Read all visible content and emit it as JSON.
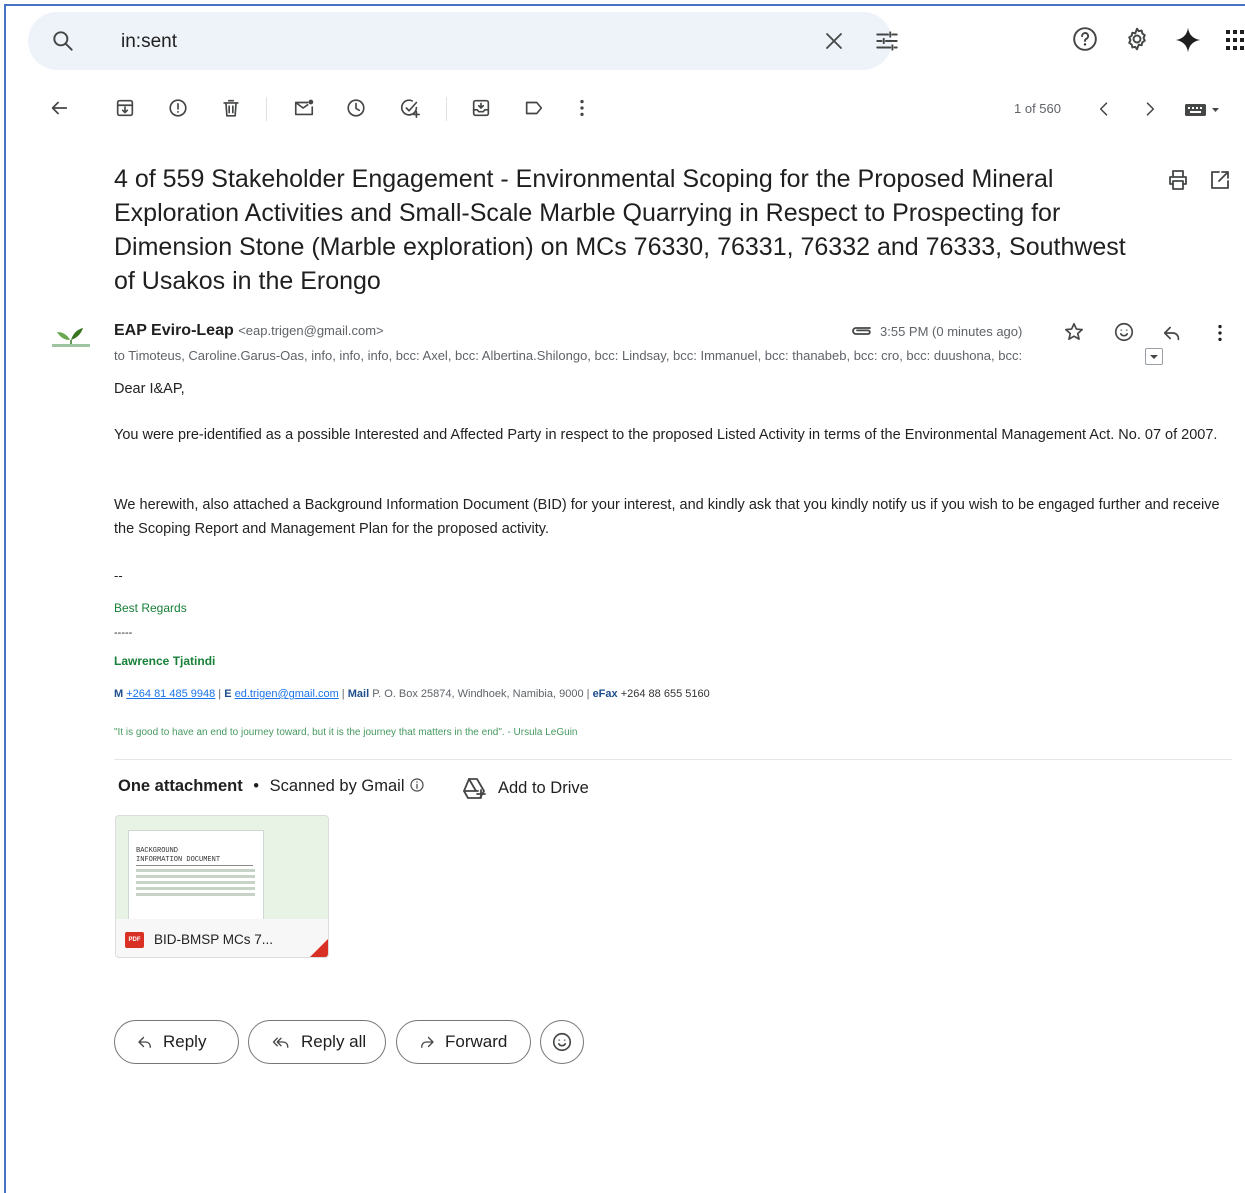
{
  "search": {
    "query": "in:sent"
  },
  "toolbar": {
    "pager": "1 of 560"
  },
  "email": {
    "subject": "4 of 559 Stakeholder Engagement - Environmental Scoping for the Proposed Mineral Exploration Activities and Small-Scale Marble Quarrying in Respect to Prospecting for Dimension Stone (Marble exploration) on MCs 76330, 76331, 76332 and 76333, Southwest of Usakos in the Erongo",
    "sender_name": "EAP Eviro-Leap",
    "sender_email": "<eap.trigen@gmail.com>",
    "time": "3:55 PM (0 minutes ago)",
    "recipients": "to Timoteus, Caroline.Garus-Oas, info, info, info, bcc: Axel, bcc: Albertina.Shilongo, bcc: Lindsay, bcc: Immanuel, bcc: thanabeb, bcc: cro, bcc: duushona, bcc:",
    "greeting": "Dear I&AP,",
    "para1": "You were pre-identified as a possible Interested and Affected Party in respect to the proposed Listed Activity in terms of the Environmental Management Act. No. 07 of 2007.",
    "para2": "We herewith, also attached a Background Information Document (BID) for your interest, and kindly ask that you kindly notify us if you wish to be engaged further and receive the Scoping Report and Management Plan for the proposed activity.",
    "sig_dashes": "--",
    "sig_regards": "Best Regards",
    "sig_rule": "-----",
    "sig_name": "Lawrence Tjatindi",
    "sig_m_label": "M",
    "sig_m_value": "+264 81 485 9948",
    "sig_e_label": "E",
    "sig_e_value": "ed.trigen@gmail.com",
    "sig_mail_label": "Mail",
    "sig_mail_value": "P. O. Box 25874,   Windhoek, Namibia, 9000",
    "sig_fax_label": "eFax",
    "sig_fax_value": "+264 88 655 5160",
    "sig_quote": "\"It is good to have an end to journey toward, but it is the journey that matters in the end\". - Ursula LeGuin"
  },
  "attachments": {
    "count_label": "One attachment",
    "dot": "•",
    "scanned": "Scanned by Gmail",
    "add_to_drive": "Add to Drive",
    "file_name": "BID-BMSP MCs 7...",
    "file_type": "PDF",
    "thumb_title_1": "BACKGROUND",
    "thumb_title_2": "INFORMATION DOCUMENT"
  },
  "actions": {
    "reply": "Reply",
    "reply_all": "Reply all",
    "forward": "Forward"
  }
}
